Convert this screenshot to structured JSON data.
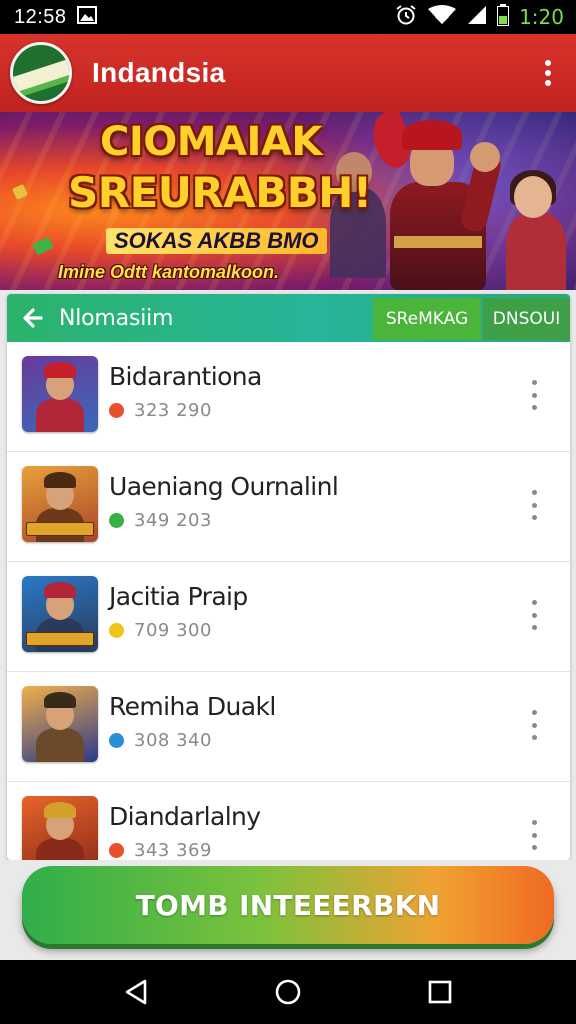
{
  "status_bar": {
    "time": "12:58",
    "clock_right": "1:20",
    "icons": [
      "image-icon",
      "alarm-icon",
      "wifi-icon",
      "signal-icon",
      "battery-icon"
    ]
  },
  "app_bar": {
    "title": "Indandsia",
    "brand_color": "#c9262a"
  },
  "banner": {
    "heading_line1": "CIOMAIAK",
    "heading_line2": "SREURABBH!",
    "subheading": "SOKAS AKBB BMO",
    "tagline": "Imine Odtt kantomalkoon."
  },
  "section": {
    "title": "Nlomasiim",
    "tabs": [
      "SReMKAG",
      "DNSOUI"
    ]
  },
  "games": [
    {
      "name": "Bidarantiona",
      "count": "323 290",
      "dot_color": "#e8502a",
      "thumb": [
        "#6a3a9a",
        "#b3263a",
        "#3a6ab8"
      ]
    },
    {
      "name": "Uaeniang Ournalinl",
      "count": "349 203",
      "dot_color": "#37b04a",
      "thumb": [
        "#e8a23a",
        "#6a3a1a",
        "#a8442a"
      ]
    },
    {
      "name": "Jacitia Praip",
      "count": "709 300",
      "dot_color": "#f0c417",
      "thumb": [
        "#2a7ac8",
        "#b3263a",
        "#2a3a5a"
      ]
    },
    {
      "name": "Remiha Duakl",
      "count": "308 340",
      "dot_color": "#2a8fd8",
      "thumb": [
        "#f0b04a",
        "#2a3a8a",
        "#6a4a2a"
      ]
    },
    {
      "name": "Diandarlalny",
      "count": "343 369",
      "dot_color": "#e8502a",
      "thumb": [
        "#e8642a",
        "#d4a02a",
        "#8a2a1a"
      ]
    }
  ],
  "cta": {
    "label": "TOMB INTEEERBKN"
  },
  "nav": {
    "buttons": [
      "back-icon",
      "home-icon",
      "recents-icon"
    ]
  }
}
